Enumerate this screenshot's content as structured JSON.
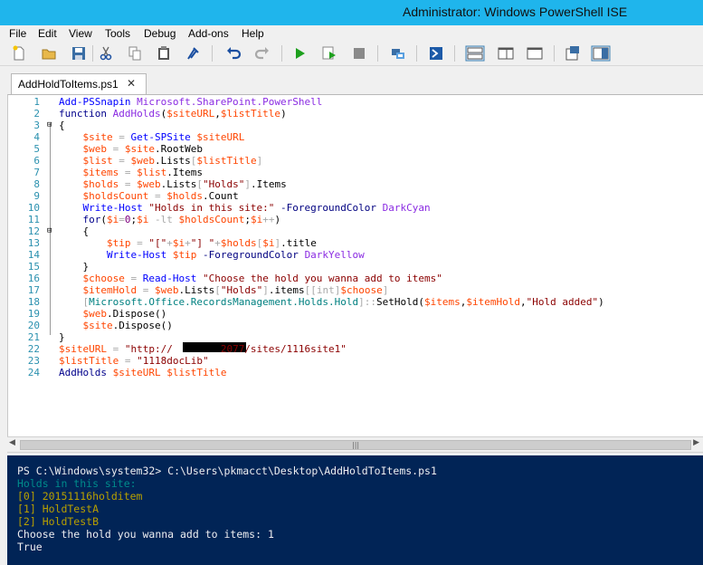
{
  "window": {
    "title": "Administrator: Windows PowerShell ISE"
  },
  "menu": [
    "File",
    "Edit",
    "View",
    "Tools",
    "Debug",
    "Add-ons",
    "Help"
  ],
  "toolbar": {
    "icons": [
      "new-file-icon",
      "open-folder-icon",
      "save-icon",
      "cut-icon",
      "copy-icon",
      "paste-icon",
      "clear-icon",
      "undo-icon",
      "redo-icon",
      "run-icon",
      "run-selection-icon",
      "stop-icon",
      "remote-icon",
      "powershell-icon",
      "layout-top-icon",
      "layout-right-icon",
      "layout-max-icon",
      "show-commands-icon",
      "show-addon-icon"
    ]
  },
  "tab": {
    "label": "AddHoldToItems.ps1",
    "close": "✕"
  },
  "editor": {
    "lines": [
      {
        "n": "1",
        "segs": [
          {
            "t": "Add-PSSnapin ",
            "c": "#0000ff"
          },
          {
            "t": "Microsoft.SharePoint.PowerShell",
            "c": "#8a2be2"
          }
        ]
      },
      {
        "n": "2",
        "segs": [
          {
            "t": "function ",
            "c": "#00008b"
          },
          {
            "t": "AddHolds",
            "c": "#8a2be2"
          },
          {
            "t": "(",
            "c": "#000"
          },
          {
            "t": "$siteURL",
            "c": "#ff4500"
          },
          {
            "t": ",",
            "c": "#000"
          },
          {
            "t": "$listTitle",
            "c": "#ff4500"
          },
          {
            "t": ")",
            "c": "#000"
          }
        ]
      },
      {
        "n": "3",
        "segs": [
          {
            "t": "{",
            "c": "#000"
          }
        ]
      },
      {
        "n": "4",
        "segs": [
          {
            "t": "    $site",
            "c": "#ff4500"
          },
          {
            "t": " = ",
            "c": "#a9a9a9"
          },
          {
            "t": "Get-SPSite ",
            "c": "#0000ff"
          },
          {
            "t": "$siteURL",
            "c": "#ff4500"
          }
        ]
      },
      {
        "n": "5",
        "segs": [
          {
            "t": "    $web",
            "c": "#ff4500"
          },
          {
            "t": " = ",
            "c": "#a9a9a9"
          },
          {
            "t": "$site",
            "c": "#ff4500"
          },
          {
            "t": ".RootWeb",
            "c": "#000"
          }
        ]
      },
      {
        "n": "6",
        "segs": [
          {
            "t": "    $list",
            "c": "#ff4500"
          },
          {
            "t": " = ",
            "c": "#a9a9a9"
          },
          {
            "t": "$web",
            "c": "#ff4500"
          },
          {
            "t": ".Lists",
            "c": "#000"
          },
          {
            "t": "[",
            "c": "#a9a9a9"
          },
          {
            "t": "$listTitle",
            "c": "#ff4500"
          },
          {
            "t": "]",
            "c": "#a9a9a9"
          }
        ]
      },
      {
        "n": "7",
        "segs": [
          {
            "t": "    $items",
            "c": "#ff4500"
          },
          {
            "t": " = ",
            "c": "#a9a9a9"
          },
          {
            "t": "$list",
            "c": "#ff4500"
          },
          {
            "t": ".Items",
            "c": "#000"
          }
        ]
      },
      {
        "n": "8",
        "segs": [
          {
            "t": "    $holds",
            "c": "#ff4500"
          },
          {
            "t": " = ",
            "c": "#a9a9a9"
          },
          {
            "t": "$web",
            "c": "#ff4500"
          },
          {
            "t": ".Lists",
            "c": "#000"
          },
          {
            "t": "[",
            "c": "#a9a9a9"
          },
          {
            "t": "\"Holds\"",
            "c": "#8b0000"
          },
          {
            "t": "]",
            "c": "#a9a9a9"
          },
          {
            "t": ".Items",
            "c": "#000"
          }
        ]
      },
      {
        "n": "9",
        "segs": [
          {
            "t": "    $holdsCount",
            "c": "#ff4500"
          },
          {
            "t": " = ",
            "c": "#a9a9a9"
          },
          {
            "t": "$holds",
            "c": "#ff4500"
          },
          {
            "t": ".Count",
            "c": "#000"
          }
        ]
      },
      {
        "n": "10",
        "segs": [
          {
            "t": "    Write-Host ",
            "c": "#0000ff"
          },
          {
            "t": "\"Holds in this site:\"",
            "c": "#8b0000"
          },
          {
            "t": " -ForegroundColor ",
            "c": "#000080"
          },
          {
            "t": "DarkCyan",
            "c": "#8a2be2"
          }
        ]
      },
      {
        "n": "11",
        "segs": [
          {
            "t": "    for",
            "c": "#00008b"
          },
          {
            "t": "(",
            "c": "#000"
          },
          {
            "t": "$i",
            "c": "#ff4500"
          },
          {
            "t": "=",
            "c": "#a9a9a9"
          },
          {
            "t": "0",
            "c": "#800080"
          },
          {
            "t": ";",
            "c": "#000"
          },
          {
            "t": "$i",
            "c": "#ff4500"
          },
          {
            "t": " -lt ",
            "c": "#a9a9a9"
          },
          {
            "t": "$holdsCount",
            "c": "#ff4500"
          },
          {
            "t": ";",
            "c": "#000"
          },
          {
            "t": "$i",
            "c": "#ff4500"
          },
          {
            "t": "++",
            "c": "#a9a9a9"
          },
          {
            "t": ")",
            "c": "#000"
          }
        ]
      },
      {
        "n": "12",
        "segs": [
          {
            "t": "    {",
            "c": "#000"
          }
        ]
      },
      {
        "n": "13",
        "segs": [
          {
            "t": "        $tip",
            "c": "#ff4500"
          },
          {
            "t": " = ",
            "c": "#a9a9a9"
          },
          {
            "t": "\"[\"",
            "c": "#8b0000"
          },
          {
            "t": "+",
            "c": "#a9a9a9"
          },
          {
            "t": "$i",
            "c": "#ff4500"
          },
          {
            "t": "+",
            "c": "#a9a9a9"
          },
          {
            "t": "\"] \"",
            "c": "#8b0000"
          },
          {
            "t": "+",
            "c": "#a9a9a9"
          },
          {
            "t": "$holds",
            "c": "#ff4500"
          },
          {
            "t": "[",
            "c": "#a9a9a9"
          },
          {
            "t": "$i",
            "c": "#ff4500"
          },
          {
            "t": "]",
            "c": "#a9a9a9"
          },
          {
            "t": ".title",
            "c": "#000"
          }
        ]
      },
      {
        "n": "14",
        "segs": [
          {
            "t": "        Write-Host ",
            "c": "#0000ff"
          },
          {
            "t": "$tip",
            "c": "#ff4500"
          },
          {
            "t": " -ForegroundColor ",
            "c": "#000080"
          },
          {
            "t": "DarkYellow",
            "c": "#8a2be2"
          }
        ]
      },
      {
        "n": "15",
        "segs": [
          {
            "t": "    }",
            "c": "#000"
          }
        ]
      },
      {
        "n": "16",
        "segs": [
          {
            "t": "    $choose",
            "c": "#ff4500"
          },
          {
            "t": " = ",
            "c": "#a9a9a9"
          },
          {
            "t": "Read-Host ",
            "c": "#0000ff"
          },
          {
            "t": "\"Choose the hold you wanna add to items\"",
            "c": "#8b0000"
          }
        ]
      },
      {
        "n": "17",
        "segs": [
          {
            "t": "    $itemHold",
            "c": "#ff4500"
          },
          {
            "t": " = ",
            "c": "#a9a9a9"
          },
          {
            "t": "$web",
            "c": "#ff4500"
          },
          {
            "t": ".Lists",
            "c": "#000"
          },
          {
            "t": "[",
            "c": "#a9a9a9"
          },
          {
            "t": "\"Holds\"",
            "c": "#8b0000"
          },
          {
            "t": "]",
            "c": "#a9a9a9"
          },
          {
            "t": ".items",
            "c": "#000"
          },
          {
            "t": "[[int]",
            "c": "#a9a9a9"
          },
          {
            "t": "$choose",
            "c": "#ff4500"
          },
          {
            "t": "]",
            "c": "#a9a9a9"
          }
        ]
      },
      {
        "n": "18",
        "segs": [
          {
            "t": "    [",
            "c": "#a9a9a9"
          },
          {
            "t": "Microsoft.Office.RecordsManagement.Holds.Hold",
            "c": "#008080"
          },
          {
            "t": "]",
            "c": "#a9a9a9"
          },
          {
            "t": "::",
            "c": "#a9a9a9"
          },
          {
            "t": "SetHold(",
            "c": "#000"
          },
          {
            "t": "$items",
            "c": "#ff4500"
          },
          {
            "t": ",",
            "c": "#000"
          },
          {
            "t": "$itemHold",
            "c": "#ff4500"
          },
          {
            "t": ",",
            "c": "#000"
          },
          {
            "t": "\"Hold added\"",
            "c": "#8b0000"
          },
          {
            "t": ")",
            "c": "#000"
          }
        ]
      },
      {
        "n": "19",
        "segs": [
          {
            "t": "    $web",
            "c": "#ff4500"
          },
          {
            "t": ".Dispose()",
            "c": "#000"
          }
        ]
      },
      {
        "n": "20",
        "segs": [
          {
            "t": "    $site",
            "c": "#ff4500"
          },
          {
            "t": ".Dispose()",
            "c": "#000"
          }
        ]
      },
      {
        "n": "21",
        "segs": [
          {
            "t": "}",
            "c": "#000"
          }
        ]
      },
      {
        "n": "22",
        "segs": [
          {
            "t": "$siteURL",
            "c": "#ff4500"
          },
          {
            "t": " = ",
            "c": "#a9a9a9"
          },
          {
            "t": "\"http://        2077/sites/1116site1\"",
            "c": "#8b0000"
          }
        ]
      },
      {
        "n": "23",
        "segs": [
          {
            "t": "$listTitle",
            "c": "#ff4500"
          },
          {
            "t": " = ",
            "c": "#a9a9a9"
          },
          {
            "t": "\"1118docLib\"",
            "c": "#8b0000"
          }
        ]
      },
      {
        "n": "24",
        "segs": [
          {
            "t": "AddHolds ",
            "c": "#00008b"
          },
          {
            "t": "$siteURL ",
            "c": "#ff4500"
          },
          {
            "t": "$listTitle",
            "c": "#ff4500"
          }
        ]
      }
    ]
  },
  "console": {
    "lines": [
      {
        "t": "PS C:\\Windows\\system32> C:\\Users\\pkmacct\\Desktop\\AddHoldToItems.ps1",
        "c": "#eeedf0"
      },
      {
        "t": "Holds in this site:",
        "c": "#008b8b"
      },
      {
        "t": "[0] 20151116holditem",
        "c": "#b8a000"
      },
      {
        "t": "[1] HoldTestA",
        "c": "#b8a000"
      },
      {
        "t": "[2] HoldTestB",
        "c": "#b8a000"
      },
      {
        "t": "Choose the hold you wanna add to items: 1",
        "c": "#eeedf0"
      },
      {
        "t": "True",
        "c": "#eeedf0"
      }
    ]
  },
  "colors": {
    "titlebar": "#1fb5ec",
    "console_bg": "#012456",
    "line_numbers": "#2b91af"
  }
}
